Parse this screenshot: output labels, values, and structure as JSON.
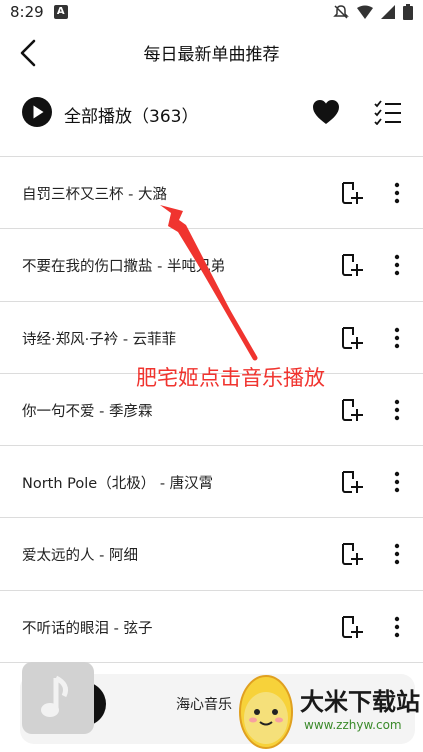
{
  "status_bar": {
    "time": "8:29",
    "notification_glyph": "A"
  },
  "header": {
    "title": "每日最新单曲推荐"
  },
  "play_all": {
    "label": "全部播放（363）"
  },
  "songs": [
    {
      "title": "自罚三杯又三杯 - 大潞"
    },
    {
      "title": "不要在我的伤口撒盐 - 半吨兄弟"
    },
    {
      "title": "诗经·郑风·子衿 - 云菲菲"
    },
    {
      "title": "你一句不爱 - 季彦霖"
    },
    {
      "title": "North Pole（北极） - 唐汉霄"
    },
    {
      "title": "爱太远的人 - 阿细"
    },
    {
      "title": "不听话的眼泪 - 弦子"
    }
  ],
  "annotation": {
    "text": "肥宅姬点击音乐播放"
  },
  "player": {
    "track": "海心音乐"
  },
  "watermark": {
    "title": "大米下载站",
    "url": "www.zzhyw.com"
  },
  "colors": {
    "accent": "#111111",
    "annotation": "#f0342f",
    "divider": "#dcdcdc"
  }
}
